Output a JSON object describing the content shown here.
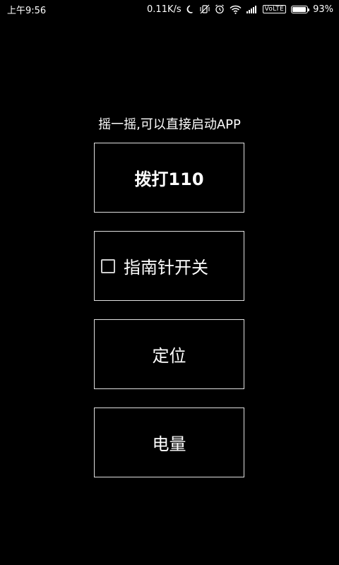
{
  "status_bar": {
    "time": "上午9:56",
    "net_speed": "0.11K/s",
    "volte": "VoLTE",
    "battery_percent": "93%",
    "battery_level": 0.93,
    "icons": [
      "moon-icon",
      "vibrate-off-icon",
      "alarm-icon",
      "wifi-icon",
      "signal-icon",
      "battery-icon"
    ]
  },
  "main": {
    "hint": "摇一摇,可以直接启动APP",
    "call_button": "拨打110",
    "compass_toggle": {
      "label": "指南针开关",
      "checked": false
    },
    "locate_button": "定位",
    "battery_button": "电量"
  },
  "colors": {
    "background": "#000000",
    "text": "#ffffff",
    "border": "#e0e0e0"
  }
}
